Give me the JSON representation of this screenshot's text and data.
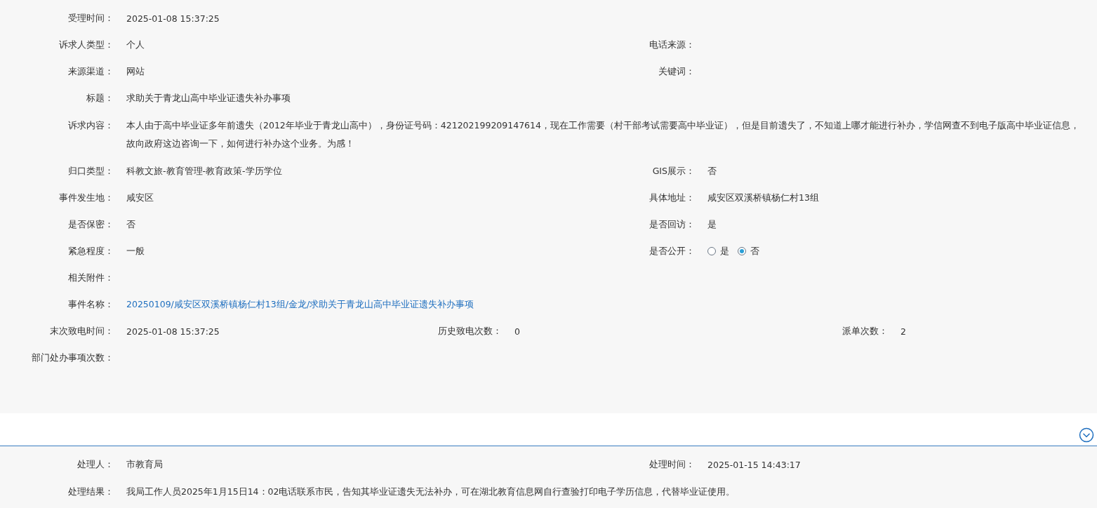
{
  "detail": {
    "rows": [
      {
        "kind": "pair",
        "left": {
          "label": "受理时间：",
          "value": "2025-01-08 15:37:25"
        }
      },
      {
        "kind": "pair",
        "left": {
          "label": "诉求人类型：",
          "value": "个人"
        },
        "right": {
          "label": "电话来源："
        }
      },
      {
        "kind": "pair",
        "left": {
          "label": "来源渠道：",
          "value": "网站"
        },
        "right": {
          "label": "关键词："
        }
      },
      {
        "kind": "pair",
        "left": {
          "label": "标题：",
          "value": "求助关于青龙山高中毕业证遗失补办事项"
        }
      },
      {
        "kind": "wide",
        "left": {
          "label": "诉求内容：",
          "value": "本人由于高中毕业证多年前遗失（2012年毕业于青龙山高中），身份证号码：421202199209147614，现在工作需要（村干部考试需要高中毕业证），但是目前遗失了，不知道上哪才能进行补办，学信网查不到电子版高中毕业证信息，故向政府这边咨询一下，如何进行补办这个业务。为感！"
        }
      },
      {
        "kind": "pair",
        "left": {
          "label": "归口类型：",
          "value": "科教文旅-教育管理-教育政策-学历学位"
        },
        "right": {
          "label": "GIS展示：",
          "value": "否"
        }
      },
      {
        "kind": "pair",
        "left": {
          "label": "事件发生地：",
          "value": "咸安区"
        },
        "right": {
          "label": "具体地址：",
          "value": "咸安区双溪桥镇杨仁村13组"
        }
      },
      {
        "kind": "pair",
        "left": {
          "label": "是否保密：",
          "value": "否"
        },
        "right": {
          "label": "是否回访：",
          "value": "是"
        }
      },
      {
        "kind": "pair",
        "left": {
          "label": "紧急程度：",
          "value": "一般"
        },
        "right": {
          "label": "是否公开：",
          "options": [
            {
              "label": "是",
              "selected": false
            },
            {
              "label": "否",
              "selected": true
            }
          ]
        }
      },
      {
        "kind": "pair",
        "left": {
          "label": "相关附件："
        }
      },
      {
        "kind": "pair",
        "left": {
          "label": "事件名称：",
          "link": "20250109/咸安区双溪桥镇杨仁村13组/金龙/求助关于青龙山高中毕业证遗失补办事项"
        }
      },
      {
        "kind": "triple",
        "cells": [
          {
            "label": "末次致电时间：",
            "value": "2025-01-08 15:37:25"
          },
          {
            "label": "历史致电次数：",
            "value": "0"
          },
          {
            "label": "派单次数：",
            "value": "2"
          }
        ]
      },
      {
        "kind": "pair",
        "left": {
          "label": "部门处办事项次数："
        }
      }
    ]
  },
  "handling": {
    "rows": [
      {
        "kind": "pair",
        "left": {
          "label": "处理人：",
          "value": "市教育局"
        },
        "right": {
          "label": "处理时间：",
          "value": "2025-01-15 14:43:17"
        }
      },
      {
        "kind": "wide",
        "left": {
          "label": "处理结果：",
          "value": "我局工作人员2025年1月15日14：02电话联系市民，告知其毕业证遗失无法补办，可在湖北教育信息网自行查验打印电子学历信息，代替毕业证使用。"
        }
      }
    ]
  }
}
